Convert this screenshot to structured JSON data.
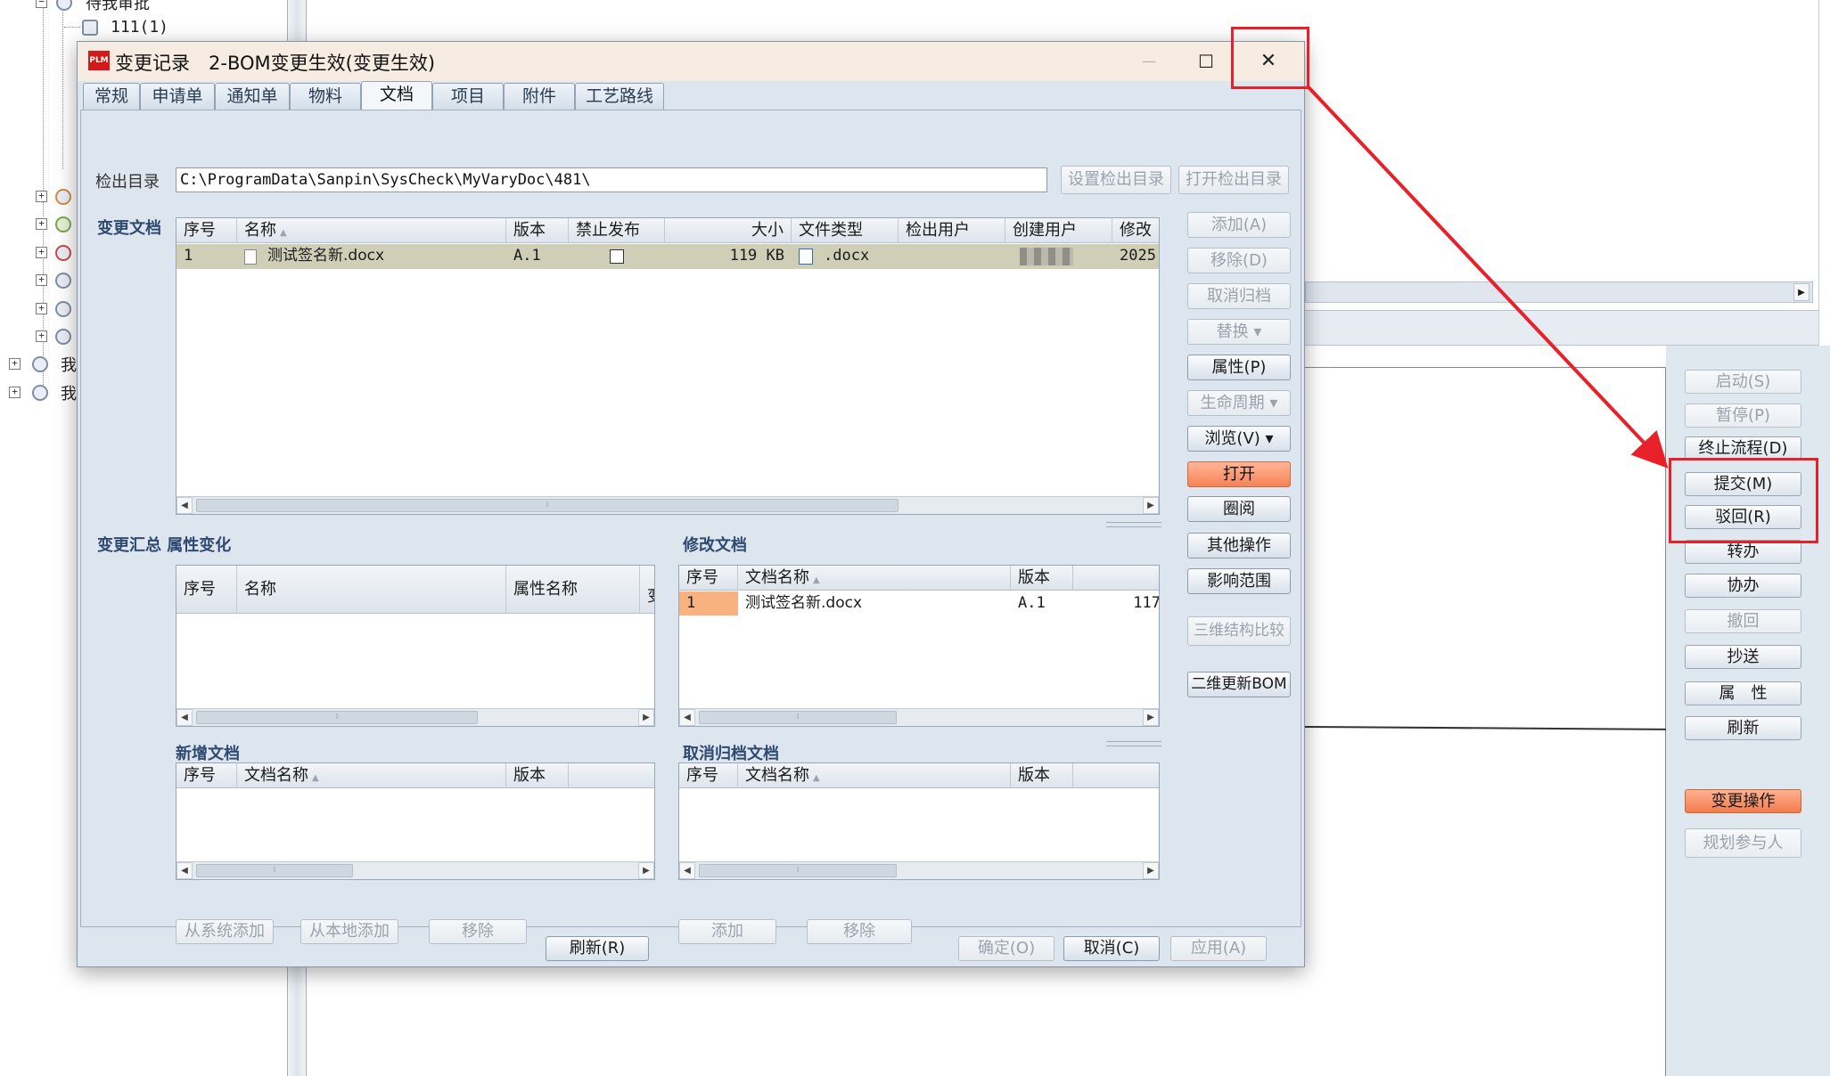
{
  "background_tree": {
    "top_item": "待我审批",
    "child_item": "111(1)",
    "bottom_items": [
      "我",
      "我"
    ]
  },
  "right_panel": {
    "buttons": [
      {
        "label": "启动(S)",
        "state": "disabled"
      },
      {
        "label": "暂停(P)",
        "state": "disabled"
      },
      {
        "label": "终止流程(D)",
        "state": "normal"
      },
      {
        "label": "提交(M)",
        "state": "normal"
      },
      {
        "label": "驳回(R)",
        "state": "normal"
      },
      {
        "label": "转办",
        "state": "normal"
      },
      {
        "label": "协办",
        "state": "normal"
      },
      {
        "label": "撤回",
        "state": "disabled"
      },
      {
        "label": "抄送",
        "state": "normal"
      },
      {
        "label": "属　性",
        "state": "normal"
      },
      {
        "label": "刷新",
        "state": "normal"
      },
      {
        "label": "变更操作",
        "state": "orange"
      },
      {
        "label": "规划参与人",
        "state": "disabled"
      }
    ]
  },
  "dialog": {
    "title": "变更记录　2-BOM变更生效(变更生效)",
    "logo_text": "PLM",
    "minimize_symbol": "—",
    "maximize_symbol": "☐",
    "close_symbol": "✕",
    "tabs": [
      "常规",
      "申请单",
      "通知单",
      "物料",
      "文档",
      "项目",
      "附件",
      "工艺路线"
    ],
    "active_tab": "文档",
    "checkout_dir_label": "检出目录",
    "checkout_dir_value": "C:\\ProgramData\\Sanpin\\SysCheck\\MyVaryDoc\\481\\",
    "set_checkout_dir_button": "设置检出目录",
    "open_checkout_dir_button": "打开检出目录",
    "changed_docs": {
      "title": "变更文档",
      "columns": [
        "序号",
        "名称",
        "版本",
        "禁止发布",
        "大小",
        "文件类型",
        "检出用户",
        "创建用户",
        "修改"
      ],
      "rows": [
        {
          "seq": "1",
          "name": "测试签名新.docx",
          "version": "A.1",
          "forbid_publish": false,
          "size": "119 KB",
          "file_type": ".docx",
          "checkout_user": "",
          "creator": "",
          "modified": "2025"
        }
      ]
    },
    "side_buttons": [
      {
        "label": "添加(A)",
        "state": "disabled"
      },
      {
        "label": "移除(D)",
        "state": "disabled"
      },
      {
        "label": "取消归档",
        "state": "disabled"
      },
      {
        "label": "替换 ▾",
        "state": "disabled"
      },
      {
        "label": "属性(P)",
        "state": "normal"
      },
      {
        "label": "生命周期 ▾",
        "state": "disabled"
      },
      {
        "label": "浏览(V) ▾",
        "state": "normal"
      },
      {
        "label": "打开",
        "state": "orange"
      },
      {
        "label": "圈阅",
        "state": "normal"
      },
      {
        "label": "其他操作",
        "state": "normal"
      },
      {
        "label": "影响范围",
        "state": "normal"
      },
      {
        "label": "三维结构比较",
        "state": "disabled"
      },
      {
        "label": "二维更新BOM",
        "state": "normal"
      }
    ],
    "change_summary": {
      "title": "变更汇总",
      "subtitle": "属性变化",
      "columns": [
        "序号",
        "名称",
        "属性名称",
        "变"
      ]
    },
    "modified_docs": {
      "title": "修改文档",
      "columns": [
        "序号",
        "文档名称",
        "版本",
        ""
      ],
      "rows": [
        {
          "seq": "1",
          "name": "测试签名新.docx",
          "version": "A.1",
          "extra": "117"
        }
      ]
    },
    "new_docs": {
      "title": "新增文档",
      "columns": [
        "序号",
        "文档名称",
        "版本",
        ""
      ]
    },
    "cancel_archive_docs": {
      "title": "取消归档文档",
      "columns": [
        "序号",
        "文档名称",
        "版本",
        ""
      ]
    },
    "new_docs_buttons": [
      "从系统添加",
      "从本地添加",
      "移除"
    ],
    "cancel_docs_buttons": [
      "添加",
      "移除"
    ],
    "footer": {
      "refresh": "刷新(R)",
      "ok": "确定(O)",
      "cancel": "取消(C)",
      "apply": "应用(A)"
    }
  },
  "colors": {
    "annotation": "#e8202a",
    "accent_orange": "#f58256",
    "dialog_bg": "#dde6ef",
    "selected_row": "#cfcfb8"
  }
}
